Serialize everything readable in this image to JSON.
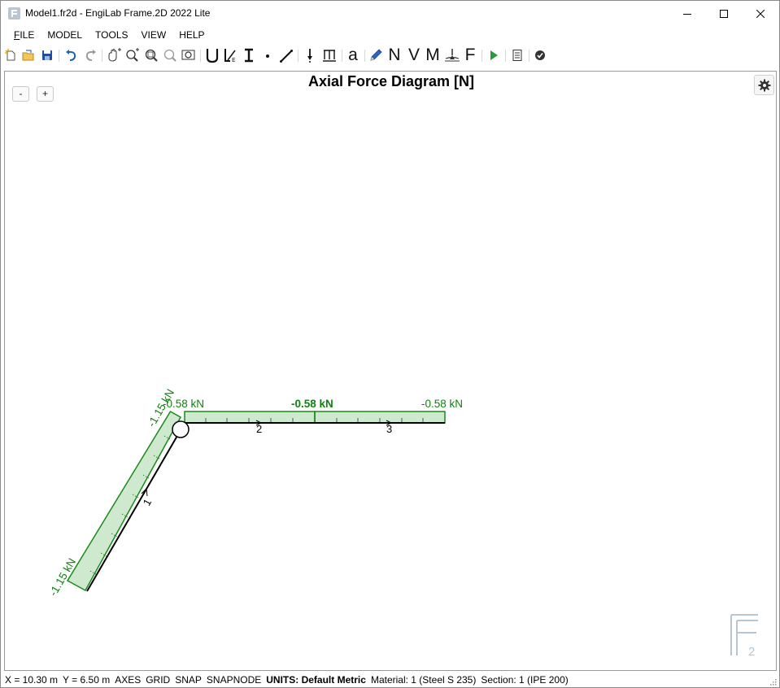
{
  "window": {
    "title": "Model1.fr2d - EngiLab Frame.2D 2022 Lite"
  },
  "menu": {
    "items": [
      {
        "label": "FILE",
        "accel": "F",
        "rest": "ILE"
      },
      {
        "label": "MODEL",
        "accel": "",
        "rest": "MODEL"
      },
      {
        "label": "TOOLS",
        "accel": "",
        "rest": "TOOLS"
      },
      {
        "label": "VIEW",
        "accel": "",
        "rest": "VIEW"
      },
      {
        "label": "HELP",
        "accel": "",
        "rest": "HELP"
      }
    ]
  },
  "toolbar": {
    "text_buttons": {
      "n": "N",
      "v": "V",
      "m": "M",
      "f": "F",
      "a": "a"
    }
  },
  "canvas": {
    "zoom_out": "-",
    "zoom_in": "+",
    "title": "Axial Force Diagram [N]",
    "labels": {
      "m1_top": "-1.15 kN",
      "m1_bottom": "-1.15 kN",
      "m2_start": "-0.58 kN",
      "m2_mid": "-0.58 kN",
      "m3_end": "-0.58 kN"
    },
    "members": {
      "m1": "1",
      "m2": "2",
      "m3": "3"
    },
    "logo_sub": "2",
    "colors": {
      "diagram_fill": "#cfe9cf",
      "diagram_stroke": "#1a8a1a",
      "label_color": "#108010",
      "member": "#000000",
      "logo": "#b7c6d3"
    }
  },
  "status": {
    "x": "X = 10.30 m",
    "y": "Y = 6.50 m",
    "axes": "AXES",
    "grid": "GRID",
    "snap": "SNAP",
    "snapnode": "SNAPNODE",
    "units": "UNITS: Default Metric",
    "material": "Material: 1 (Steel S 235)",
    "section": "Section: 1 (IPE 200)"
  }
}
